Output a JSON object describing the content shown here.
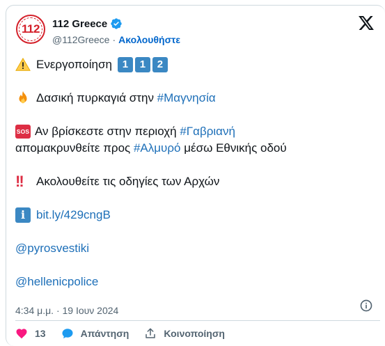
{
  "account": {
    "avatar_text": "112",
    "display_name": "112 Greece",
    "handle": "@112Greece",
    "separator": "·",
    "follow_label": "Ακολουθήστε"
  },
  "tweet": {
    "line1": {
      "text": "Ενεργοποίηση",
      "keycaps": [
        "1",
        "1",
        "2"
      ]
    },
    "line2": {
      "text": "Δασική πυρκαγιά στην ",
      "hashtag": "#Μαγνησία"
    },
    "line3": {
      "badge": "SOS",
      "text": "Αν βρίσκεστε στην περιοχή ",
      "hashtag": "#Γαβριανή"
    },
    "line4": {
      "text_before": "απομακρυνθείτε προς ",
      "hashtag": "#Αλμυρό",
      "text_after": " μέσω Εθνικής οδού"
    },
    "line5": {
      "bang": "!!",
      "text": "Ακολουθείτε τις οδηγίες των Αρχών"
    },
    "line6": {
      "info_glyph": "i",
      "link": "bit.ly/429cngB"
    },
    "mention1": "@pyrosvestiki",
    "mention2": "@hellenicpolice"
  },
  "timestamp": "4:34 μ.μ. · 19 Ιουν 2024",
  "actions": {
    "likes_count": "13",
    "reply_label": "Απάντηση",
    "share_label": "Κοινοποίηση"
  },
  "colors": {
    "link": "#1d6fb8",
    "heart": "#f91880",
    "verified": "#1d9bf0",
    "brand_red": "#d4202a"
  },
  "icons": [
    "verified-badge-icon",
    "x-logo-icon",
    "warning-icon",
    "fire-icon",
    "info-icon",
    "heart-icon",
    "reply-bubble-icon",
    "share-icon"
  ]
}
